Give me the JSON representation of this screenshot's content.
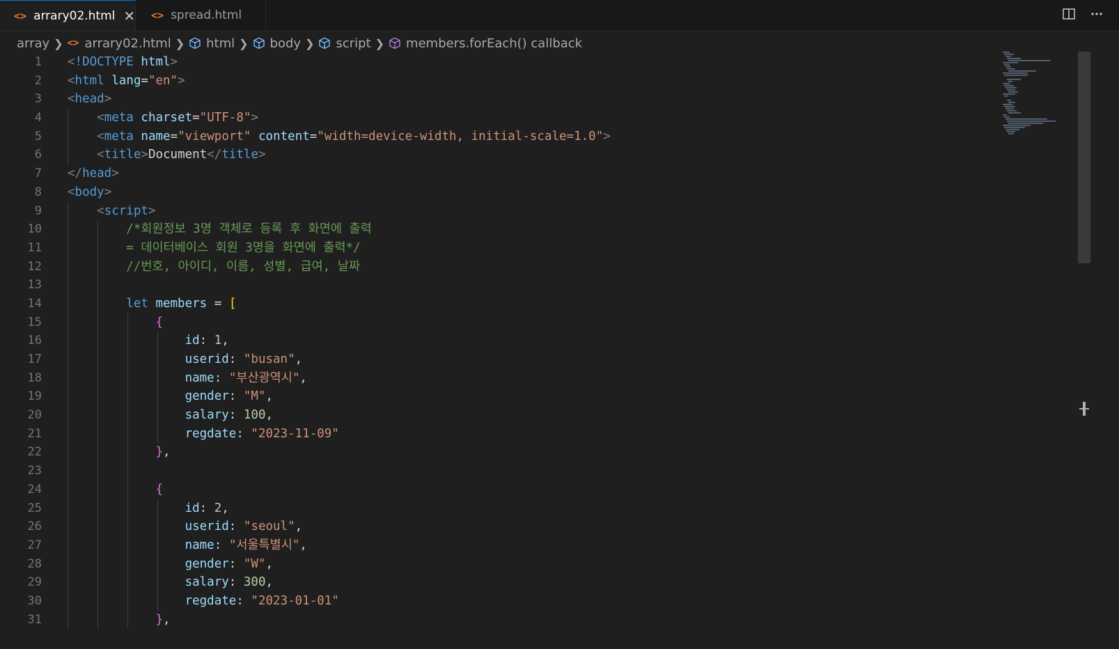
{
  "tabs": [
    {
      "label": "arrary02.html",
      "icon": "html-file-icon",
      "active": true
    },
    {
      "label": "spread.html",
      "icon": "html-file-icon",
      "active": false
    }
  ],
  "tab_icon_glyph": "<>",
  "close_glyph": "✕",
  "breadcrumb": {
    "folder": "array",
    "file": "arrary02.html",
    "html": "html",
    "body": "body",
    "script": "script",
    "symbol": "members.forEach() callback"
  },
  "colors": {
    "editor_bg": "#1f1f1f",
    "tag": "#569cd6",
    "attribute": "#9cdcfe",
    "string": "#ce9178",
    "comment": "#6a9955",
    "number": "#b5cea8",
    "bracket_level1": "#ffd700",
    "bracket_level2": "#da70d6",
    "html_icon": "#e37933",
    "symbol_icon": "#b180d7"
  },
  "code": {
    "line_numbers": [
      "1",
      "2",
      "3",
      "4",
      "5",
      "6",
      "7",
      "8",
      "9",
      "10",
      "11",
      "12",
      "13",
      "14",
      "15",
      "16",
      "17",
      "18",
      "19",
      "20",
      "21",
      "22",
      "23",
      "24",
      "25",
      "26",
      "27",
      "28",
      "29",
      "30",
      "31"
    ],
    "l1": {
      "a": "<",
      "b": "!DOCTYPE",
      "c": "html",
      "d": ">"
    },
    "l2": {
      "a": "<",
      "b": "html",
      "c": "lang",
      "d": "=",
      "e": "\"en\"",
      "f": ">"
    },
    "l3": {
      "a": "<",
      "b": "head",
      "c": ">"
    },
    "l4": {
      "a": "<",
      "b": "meta",
      "c": "charset",
      "d": "=",
      "e": "\"UTF-8\"",
      "f": ">"
    },
    "l5": {
      "a": "<",
      "b": "meta",
      "c": "name",
      "d": "=",
      "e": "\"viewport\"",
      "f": "content",
      "g": "=",
      "h": "\"width=device-width, initial-scale=1.0\"",
      "i": ">"
    },
    "l6": {
      "a": "<",
      "b": "title",
      "c": ">",
      "d": "Document",
      "e": "</",
      "f": "title",
      "g": ">"
    },
    "l7": {
      "a": "</",
      "b": "head",
      "c": ">"
    },
    "l8": {
      "a": "<",
      "b": "body",
      "c": ">"
    },
    "l9": {
      "a": "<",
      "b": "script",
      "c": ">"
    },
    "l10": "/*회원정보 3명 객체로 등록 후 화면에 출력",
    "l11": "= 데이터베이스 회원 3명을 화면에 출력*/",
    "l12": "//번호, 아이디, 이름, 성별, 급여, 날짜",
    "l14": {
      "kw": "let",
      "var": "members",
      "op": " = ",
      "br": "["
    },
    "open_brace": "{",
    "close_brace": "}",
    "comma": ",",
    "colon": ": ",
    "keys": {
      "id": "id",
      "userid": "userid",
      "name": "name",
      "gender": "gender",
      "salary": "salary",
      "regdate": "regdate"
    },
    "member1": {
      "id": "1",
      "userid": "\"busan\"",
      "name": "\"부산광역시\"",
      "gender": "\"M\"",
      "salary": "100",
      "regdate": "\"2023-11-09\""
    },
    "member2": {
      "id": "2",
      "userid": "\"seoul\"",
      "name": "\"서울특별시\"",
      "gender": "\"W\"",
      "salary": "300",
      "regdate": "\"2023-01-01\""
    }
  }
}
